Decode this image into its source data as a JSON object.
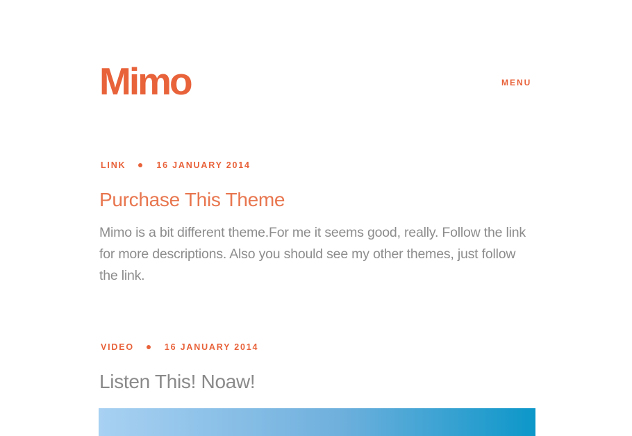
{
  "header": {
    "logo_text": "Mimo",
    "menu_label": "MENU"
  },
  "posts": [
    {
      "category": "LINK",
      "date": "16 JANUARY 2014",
      "title": "Purchase This Theme",
      "excerpt": "Mimo is a bit different theme.For me it seems good, really. Follow the link for more descriptions. Also you should see my other themes, just follow the link."
    },
    {
      "category": "VIDEO",
      "date": "16 JANUARY 2014",
      "title": "Listen This! Noaw!"
    }
  ],
  "colors": {
    "accent": "#e8623a",
    "title_link": "#e8764f",
    "body_text": "#8c8c8c",
    "video_gradient_start": "#a8d1f2",
    "video_gradient_end": "#0c97c9"
  }
}
